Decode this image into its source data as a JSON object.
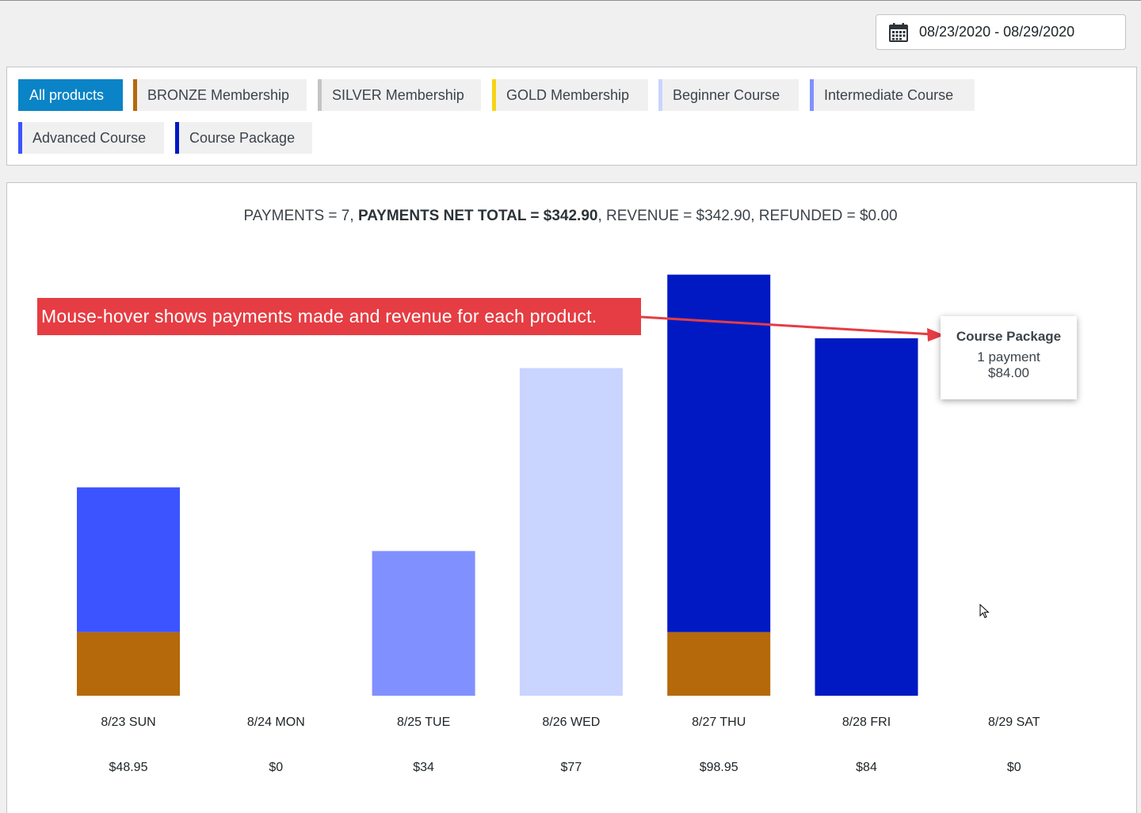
{
  "date_range": {
    "label": "08/23/2020 - 08/29/2020",
    "icon": "calendar-icon"
  },
  "filters": [
    {
      "label": "All products",
      "active": true,
      "color": ""
    },
    {
      "label": "BRONZE Membership",
      "active": false,
      "color": "#b5690b"
    },
    {
      "label": "SILVER Membership",
      "active": false,
      "color": "#c3c4c7"
    },
    {
      "label": "GOLD Membership",
      "active": false,
      "color": "#f7d313"
    },
    {
      "label": "Beginner Course",
      "active": false,
      "color": "#c9d4ff"
    },
    {
      "label": "Intermediate Course",
      "active": false,
      "color": "#8190ff"
    },
    {
      "label": "Advanced Course",
      "active": false,
      "color": "#3c54ff"
    },
    {
      "label": "Course Package",
      "active": false,
      "color": "#0019c3"
    }
  ],
  "summary": {
    "payments": "PAYMENTS = 7,",
    "net_total": "PAYMENTS NET TOTAL = $342.90",
    "rest": ", REVENUE = $342.90, REFUNDED = $0.00"
  },
  "callout": {
    "text": "Mouse-hover shows payments made and revenue for each product."
  },
  "tooltip": {
    "title": "Course Package",
    "payments": "1 payment",
    "amount": "$84.00"
  },
  "chart_data": {
    "type": "bar",
    "stacked": true,
    "categories": [
      "8/23 SUN",
      "8/24 MON",
      "8/25 TUE",
      "8/26 WED",
      "8/27 THU",
      "8/28 FRI",
      "8/29 SAT"
    ],
    "totals": [
      "$48.95",
      "$0",
      "$34",
      "$77",
      "$98.95",
      "$84",
      "$0"
    ],
    "ylim": [
      0,
      99
    ],
    "series": [
      {
        "name": "BRONZE Membership",
        "color": "#b5690b",
        "values": [
          14.95,
          0,
          0,
          0,
          14.95,
          0,
          0
        ]
      },
      {
        "name": "Beginner Course",
        "color": "#c9d4ff",
        "values": [
          0,
          0,
          0,
          77,
          0,
          0,
          0
        ]
      },
      {
        "name": "Intermediate Course",
        "color": "#8190ff",
        "values": [
          0,
          0,
          34,
          0,
          0,
          0,
          0
        ]
      },
      {
        "name": "Advanced Course",
        "color": "#3c54ff",
        "values": [
          34,
          0,
          0,
          0,
          0,
          0,
          0
        ]
      },
      {
        "name": "Course Package",
        "color": "#0019c3",
        "values": [
          0,
          0,
          0,
          0,
          84,
          84,
          0
        ]
      }
    ]
  }
}
